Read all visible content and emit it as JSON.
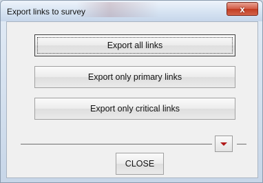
{
  "window": {
    "title": "Export links to survey",
    "close_glyph": "x"
  },
  "buttons": {
    "export_all": "Export all links",
    "export_primary": "Export only primary links",
    "export_critical": "Export only critical links",
    "close": "CLOSE"
  },
  "icons": {
    "dropdown": "chevron-down-icon",
    "dropdown_color": "#b01818"
  }
}
